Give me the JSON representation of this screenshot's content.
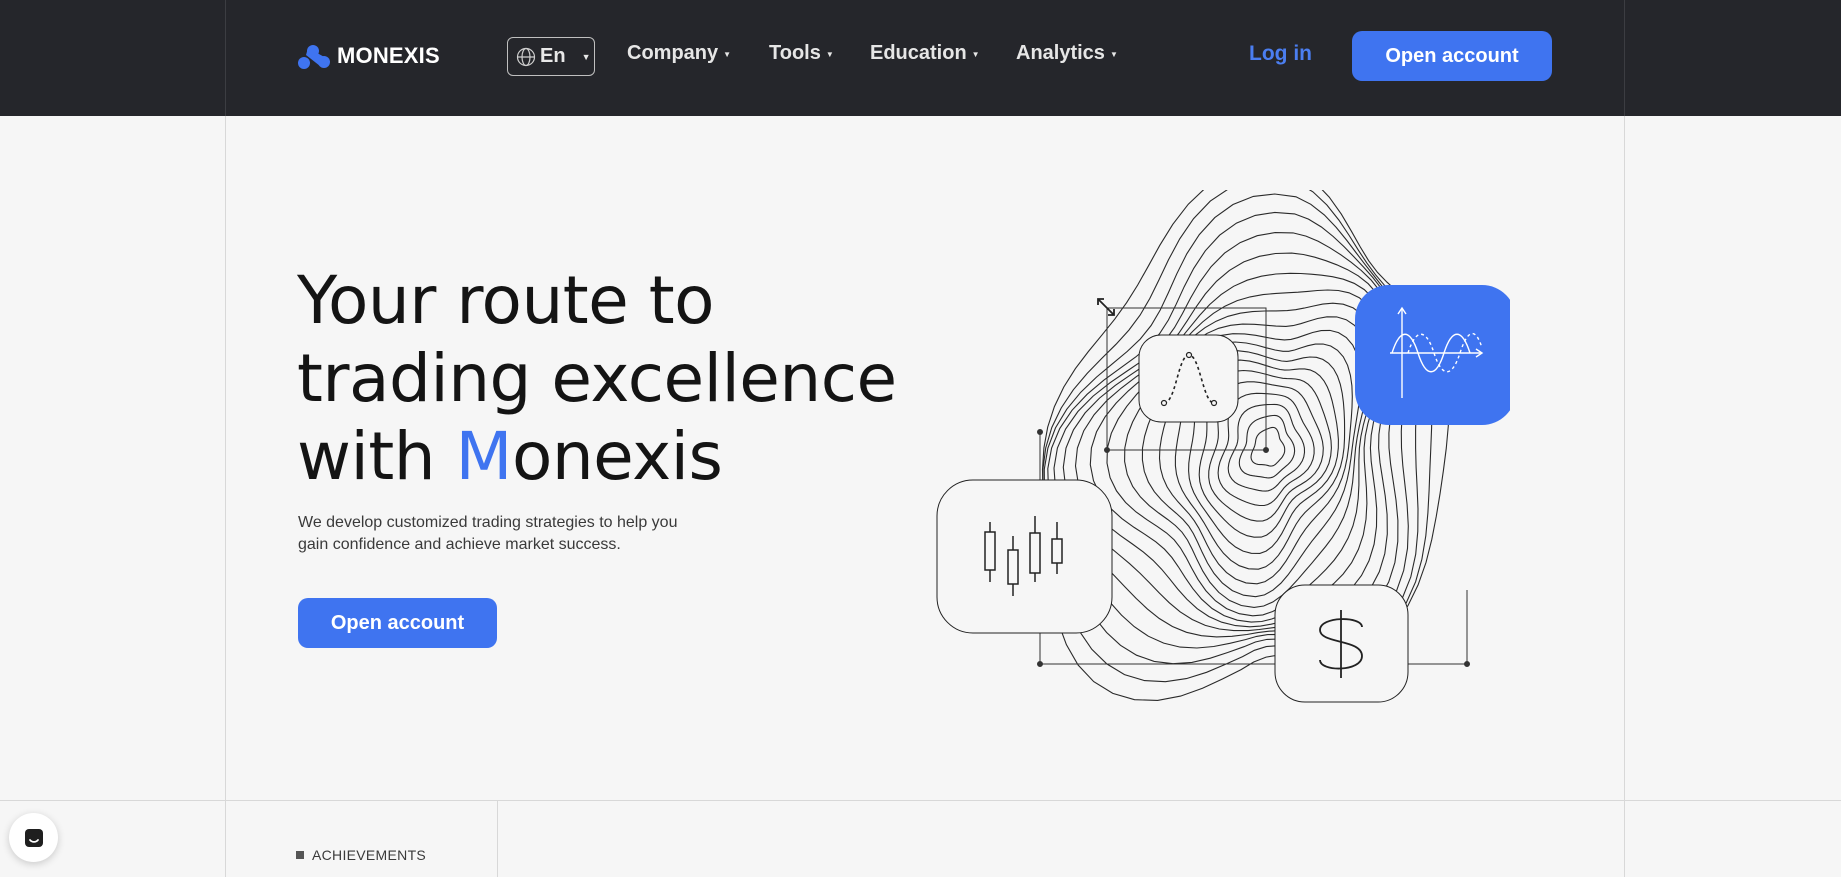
{
  "header": {
    "brand": "MONEXIS",
    "language": "En",
    "nav": [
      {
        "label": "Company"
      },
      {
        "label": "Tools"
      },
      {
        "label": "Education"
      },
      {
        "label": "Analytics"
      }
    ],
    "login_label": "Log in",
    "open_account_label": "Open account"
  },
  "hero": {
    "title_line1": "Your route to",
    "title_line2": "trading excellence",
    "title_line3_prefix": "with ",
    "title_accent_letter": "M",
    "title_line3_suffix": "onexis",
    "subtitle": "We develop customized trading strategies to help you gain confidence and achieve market success.",
    "cta_label": "Open account"
  },
  "achievements": {
    "label": "ACHIEVEMENTS"
  },
  "colors": {
    "header_bg": "#25262b",
    "accent": "#3f74f0",
    "page_bg": "#f6f6f6"
  },
  "icons": [
    "monexis-logo-icon",
    "globe-icon",
    "chevron-down-icon",
    "bell-curve-icon",
    "sine-wave-icon",
    "candlestick-icon",
    "dollar-icon",
    "resize-arrows-icon",
    "chat-icon"
  ]
}
